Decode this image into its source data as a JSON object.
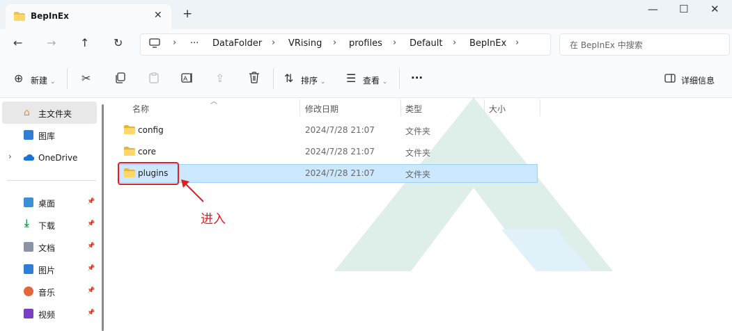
{
  "window": {
    "tab_title": "BepInEx",
    "tab_close": "✕",
    "new_tab": "+",
    "minimize": "—",
    "maximize": "☐",
    "close": "✕"
  },
  "address": {
    "more": "···",
    "crumbs": [
      "DataFolder",
      "VRising",
      "profiles",
      "Default",
      "BepInEx"
    ],
    "search_placeholder": "在 BepInEx 中搜索"
  },
  "toolbar": {
    "new_label": "新建",
    "sort_label": "排序",
    "view_label": "查看",
    "more": "···",
    "details_label": "详细信息"
  },
  "sidebar": {
    "home": "主文件夹",
    "gallery": "图库",
    "onedrive": "OneDrive",
    "quick": [
      {
        "label": "桌面",
        "icon": "desktop-icon"
      },
      {
        "label": "下载",
        "icon": "download-icon"
      },
      {
        "label": "文档",
        "icon": "document-icon"
      },
      {
        "label": "图片",
        "icon": "pictures-icon"
      },
      {
        "label": "音乐",
        "icon": "music-icon"
      },
      {
        "label": "视频",
        "icon": "video-icon"
      }
    ]
  },
  "columns": {
    "name": "名称",
    "date": "修改日期",
    "type": "类型",
    "size": "大小"
  },
  "files": [
    {
      "name": "config",
      "date": "2024/7/28 21:07",
      "type": "文件夹"
    },
    {
      "name": "core",
      "date": "2024/7/28 21:07",
      "type": "文件夹"
    },
    {
      "name": "plugins",
      "date": "2024/7/28 21:07",
      "type": "文件夹"
    }
  ],
  "annotation": {
    "text": "进入",
    "color": "#e02020"
  },
  "colors": {
    "selection": "#cce8ff",
    "folder": "#f3c14b"
  }
}
